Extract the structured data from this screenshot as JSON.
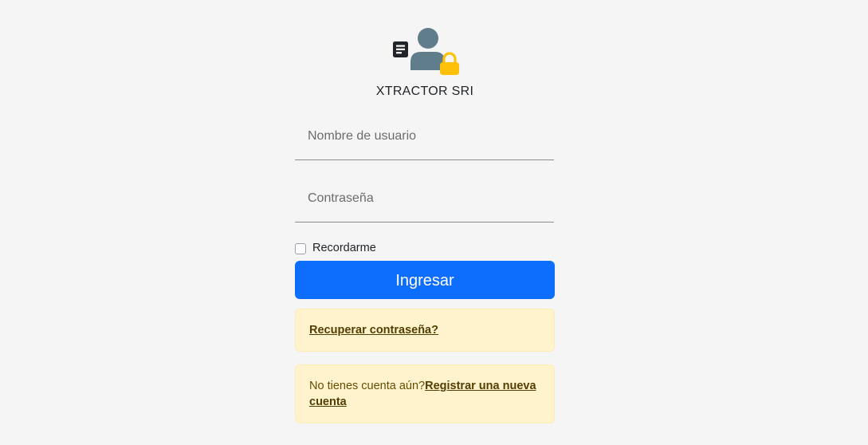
{
  "app": {
    "title": "XTRACTOR SRI",
    "logo_icon": "user-lock-document-icon"
  },
  "form": {
    "username_placeholder": "Nombre de usuario",
    "username_value": "",
    "password_placeholder": "Contraseña",
    "password_value": "",
    "remember_label": "Recordarme",
    "remember_checked": false,
    "submit_label": "Ingresar"
  },
  "alerts": {
    "recover_link": "Recuperar contraseña?",
    "register_text": "No tienes cuenta aún?",
    "register_link": "Registrar una nueva cuenta"
  },
  "colors": {
    "primary": "#0d6efd",
    "warning_bg": "#fff3cd",
    "warning_text": "#664d03",
    "background": "#f5f5f5",
    "lock": "#ffc107",
    "user": "#607d8b"
  }
}
